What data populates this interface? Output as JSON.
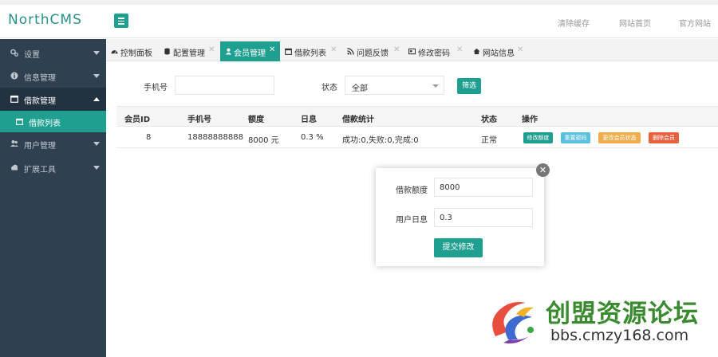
{
  "app": {
    "logo": "NorthCMS",
    "header_links": [
      "清除缓存",
      "网站首页",
      "官方网站"
    ]
  },
  "sidebar": {
    "items": [
      {
        "label": "设置",
        "icon": "gears-icon"
      },
      {
        "label": "信息管理",
        "icon": "info-icon"
      },
      {
        "label": "借款管理",
        "icon": "calendar-icon"
      },
      {
        "label": "用户管理",
        "icon": "users-icon"
      },
      {
        "label": "扩展工具",
        "icon": "cloud-icon"
      }
    ],
    "sub_item": {
      "label": "借款列表",
      "icon": "calendar-icon"
    }
  },
  "tabs": [
    {
      "label": "控制面板",
      "icon": "dashboard-icon"
    },
    {
      "label": "配置管理",
      "icon": "database-icon"
    },
    {
      "label": "会员管理",
      "icon": "user-icon"
    },
    {
      "label": "借款列表",
      "icon": "calendar-icon"
    },
    {
      "label": "问题反馈",
      "icon": "rss-icon"
    },
    {
      "label": "修改密码",
      "icon": "card-icon"
    },
    {
      "label": "网站信息",
      "icon": "home-icon"
    }
  ],
  "tab_close_glyph": "✕",
  "filter": {
    "phone_label": "手机号",
    "phone_value": "",
    "status_label": "状态",
    "status_value": "全部",
    "filter_button": "筛选"
  },
  "table": {
    "headers": [
      "会员ID",
      "手机号",
      "额度",
      "日息",
      "借款统计",
      "状态",
      "操作"
    ],
    "rows": [
      {
        "id": "8",
        "phone": "18888888888",
        "quota": "8000 元",
        "daily_rate": "0.3 %",
        "loan_stats": "成功:0,失败:0,完成:0",
        "status": "正常",
        "actions": [
          "修改额度",
          "重置密码",
          "更改会员状态",
          "删除会员"
        ]
      }
    ]
  },
  "modal": {
    "close_glyph": "✕",
    "quota_label": "借款额度",
    "quota_value": "8000",
    "rate_label": "用户日息",
    "rate_value": "0.3",
    "submit_label": "提交修改"
  },
  "watermark": {
    "title": "创盟资源论坛",
    "url": "bbs.cmzy168.com"
  },
  "colors": {
    "teal": "#1f9f8f",
    "sidebar_bg": "#2f4050",
    "btn_blue": "#5bc0de",
    "btn_yellow": "#f0ad4e",
    "btn_red": "#e8623e"
  }
}
